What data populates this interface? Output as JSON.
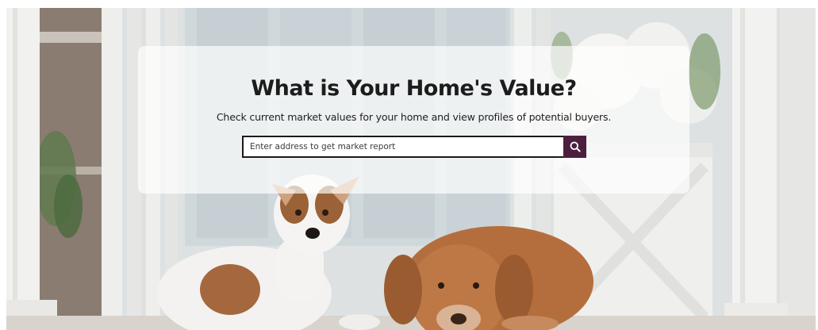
{
  "hero": {
    "title": "What is Your Home's Value?",
    "subtitle": "Check current market values for your home and view profiles of potential buyers."
  },
  "search": {
    "placeholder": "Enter address to get market report",
    "value": "",
    "button_icon": "search-icon"
  },
  "colors": {
    "search_button": "#4d1f3f",
    "title_text": "#1c1c1c",
    "panel": "#ffffff"
  }
}
